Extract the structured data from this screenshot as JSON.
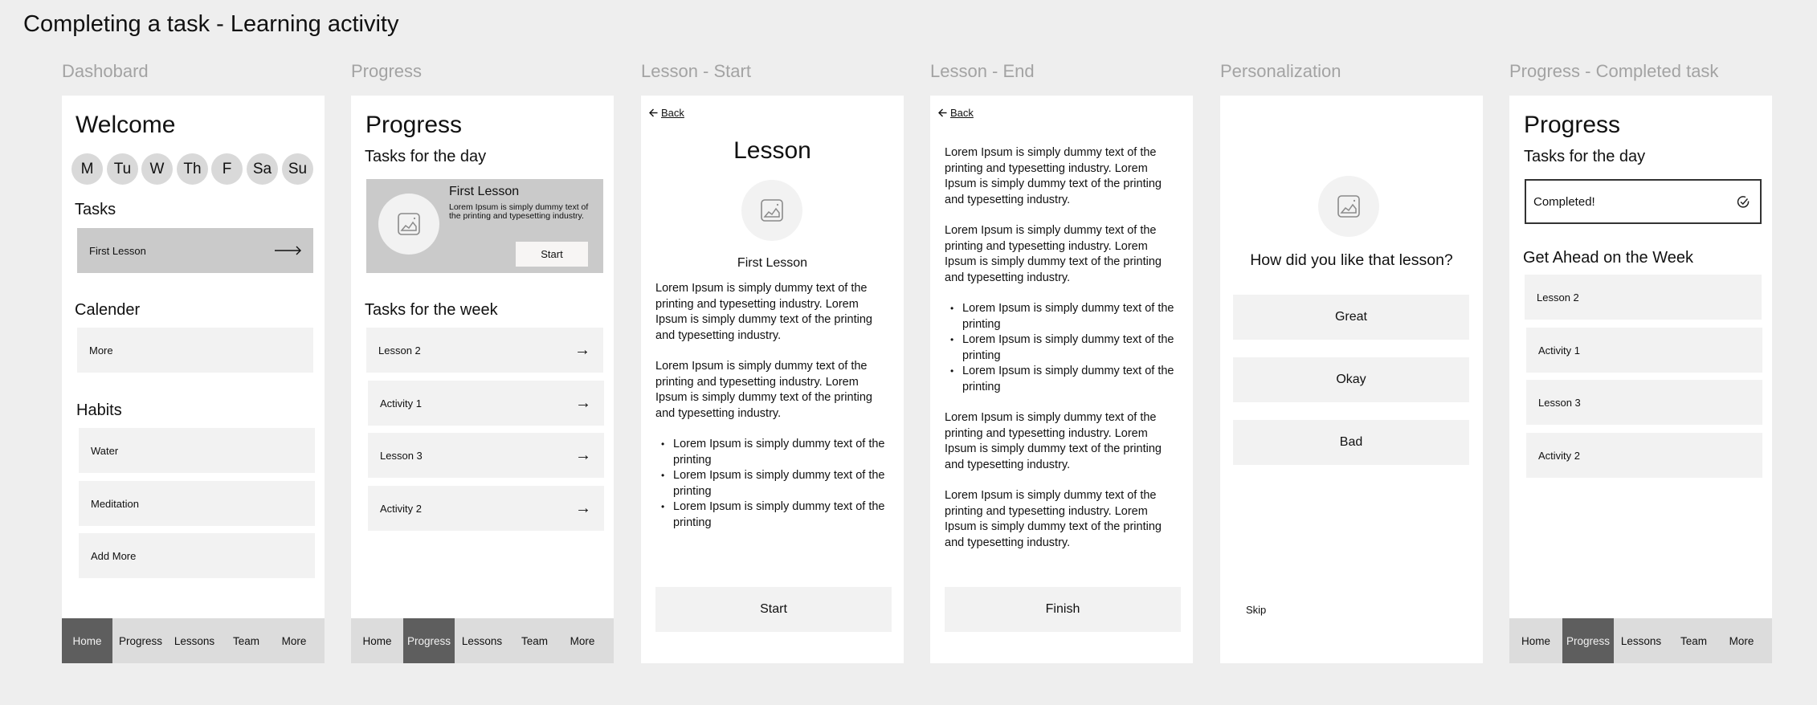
{
  "page": {
    "title": "Completing a task - Learning activity"
  },
  "frames": [
    {
      "label": "Dashobard"
    },
    {
      "label": "Progress"
    },
    {
      "label": "Lesson - Start"
    },
    {
      "label": "Lesson - End"
    },
    {
      "label": "Personalization"
    },
    {
      "label": "Progress - Completed task"
    }
  ],
  "nav": {
    "items": [
      "Home",
      "Progress",
      "Lessons",
      "Team",
      "More"
    ]
  },
  "dashboard": {
    "title": "Welcome",
    "days": [
      "M",
      "Tu",
      "W",
      "Th",
      "F",
      "Sa",
      "Su"
    ],
    "tasks_heading": "Tasks",
    "task": {
      "label": "First Lesson",
      "icon": "long-arrow-right-icon"
    },
    "calendar_heading": "Calender",
    "calendar_item": "More",
    "habits_heading": "Habits",
    "habits": [
      "Water",
      "Meditation",
      "Add More"
    ],
    "active_nav": "Home"
  },
  "progress": {
    "title": "Progress",
    "day_heading": "Tasks for the day",
    "featured": {
      "title": "First Lesson",
      "description": "Lorem Ipsum is simply dummy text of the printing and typesetting industry.",
      "button": "Start",
      "icon": "image-placeholder-icon"
    },
    "week_heading": "Tasks for the week",
    "week_tasks": [
      "Lesson 2",
      "Activity 1",
      "Lesson 3",
      "Activity 2"
    ],
    "active_nav": "Progress"
  },
  "lesson_start": {
    "back": "Back",
    "title": "Lesson",
    "subtitle": "First Lesson",
    "paragraphs": [
      "Lorem Ipsum is simply dummy text of the printing and typesetting industry. Lorem Ipsum is simply dummy text of the printing and typesetting industry.",
      "Lorem Ipsum is simply dummy text of the printing and typesetting industry. Lorem Ipsum is simply dummy text of the printing and typesetting industry."
    ],
    "bullets": [
      "Lorem Ipsum is simply dummy text of the printing",
      "Lorem Ipsum is simply dummy text of the printing",
      "Lorem Ipsum is simply dummy text of the printing"
    ],
    "button": "Start"
  },
  "lesson_end": {
    "back": "Back",
    "paragraphs_top": [
      "Lorem Ipsum is simply dummy text of the printing and typesetting industry. Lorem Ipsum is simply dummy text of the printing and typesetting industry.",
      "Lorem Ipsum is simply dummy text of the printing and typesetting industry. Lorem Ipsum is simply dummy text of the printing and typesetting industry."
    ],
    "bullets": [
      "Lorem Ipsum is simply dummy text of the printing",
      "Lorem Ipsum is simply dummy text of the printing",
      "Lorem Ipsum is simply dummy text of the printing"
    ],
    "paragraphs_bottom": [
      "Lorem Ipsum is simply dummy text of the printing and typesetting industry. Lorem Ipsum is simply dummy text of the printing and typesetting industry.",
      "Lorem Ipsum is simply dummy text of the printing and typesetting industry. Lorem Ipsum is simply dummy text of the printing and typesetting industry."
    ],
    "button": "Finish"
  },
  "personalization": {
    "question": "How did you like that lesson?",
    "options": [
      "Great",
      "Okay",
      "Bad"
    ],
    "skip": "Skip"
  },
  "progress_completed": {
    "title": "Progress",
    "day_heading": "Tasks for the day",
    "completed_label": "Completed!",
    "completed_icon": "check-circle-icon",
    "week_heading": "Get Ahead on the Week",
    "week_tasks": [
      "Lesson 2",
      "Activity 1",
      "Lesson 3",
      "Activity 2"
    ],
    "active_nav": "Progress"
  },
  "colors": {
    "canvas": "#eeeeee",
    "frame": "#ffffff",
    "card": "#f2f2f2",
    "card_highlight": "#cacaca",
    "nav_bar": "#dcdcdc",
    "nav_active": "#5e5e5e",
    "label_muted": "#a3a3a3"
  }
}
